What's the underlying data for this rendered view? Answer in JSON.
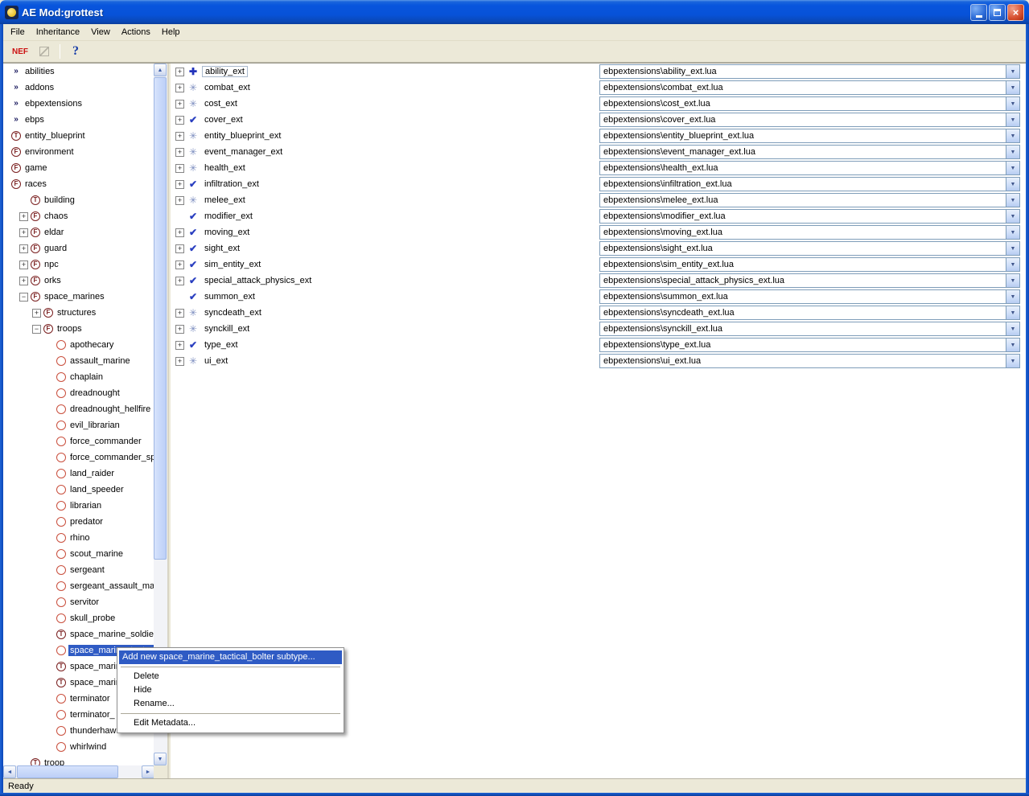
{
  "window": {
    "title": "AE Mod:grottest",
    "status": "Ready"
  },
  "menu": {
    "items": [
      "File",
      "Inheritance",
      "View",
      "Actions",
      "Help"
    ]
  },
  "toolbar": {
    "nef_label": "NEF",
    "help_label": "?"
  },
  "icons": {
    "chevron": "»",
    "plus": "✚",
    "gear": "✳",
    "check": "✔",
    "combo_arrow": "▼",
    "scroll_up": "▲",
    "scroll_down": "▼",
    "scroll_left": "◄",
    "scroll_right": "►",
    "expand_plus": "+",
    "expand_minus": "−"
  },
  "tree": {
    "items": [
      {
        "label": "abilities",
        "indent": 0,
        "icon": "chevron"
      },
      {
        "label": "addons",
        "indent": 0,
        "icon": "chevron"
      },
      {
        "label": "ebpextensions",
        "indent": 0,
        "icon": "chevron"
      },
      {
        "label": "ebps",
        "indent": 0,
        "icon": "chevron"
      },
      {
        "label": "entity_blueprint",
        "indent": 0,
        "icon": "T"
      },
      {
        "label": "environment",
        "indent": 0,
        "icon": "F"
      },
      {
        "label": "game",
        "indent": 0,
        "icon": "F"
      },
      {
        "label": "races",
        "indent": 0,
        "icon": "F"
      },
      {
        "label": "building",
        "indent": 1,
        "icon": "T"
      },
      {
        "label": "chaos",
        "indent": 1,
        "icon": "F",
        "expand": "+"
      },
      {
        "label": "eldar",
        "indent": 1,
        "icon": "F",
        "expand": "+"
      },
      {
        "label": "guard",
        "indent": 1,
        "icon": "F",
        "expand": "+"
      },
      {
        "label": "npc",
        "indent": 1,
        "icon": "F",
        "expand": "+"
      },
      {
        "label": "orks",
        "indent": 1,
        "icon": "F",
        "expand": "+"
      },
      {
        "label": "space_marines",
        "indent": 1,
        "icon": "F",
        "expand": "-"
      },
      {
        "label": "structures",
        "indent": 2,
        "icon": "F",
        "expand": "+"
      },
      {
        "label": "troops",
        "indent": 2,
        "icon": "F",
        "expand": "-"
      },
      {
        "label": "apothecary",
        "indent": 3,
        "icon": "circle"
      },
      {
        "label": "assault_marine",
        "indent": 3,
        "icon": "circle"
      },
      {
        "label": "chaplain",
        "indent": 3,
        "icon": "circle"
      },
      {
        "label": "dreadnought",
        "indent": 3,
        "icon": "circle"
      },
      {
        "label": "dreadnought_hellfire",
        "indent": 3,
        "icon": "circle"
      },
      {
        "label": "evil_librarian",
        "indent": 3,
        "icon": "circle"
      },
      {
        "label": "force_commander",
        "indent": 3,
        "icon": "circle"
      },
      {
        "label": "force_commander_sp",
        "indent": 3,
        "icon": "circle"
      },
      {
        "label": "land_raider",
        "indent": 3,
        "icon": "circle"
      },
      {
        "label": "land_speeder",
        "indent": 3,
        "icon": "circle"
      },
      {
        "label": "librarian",
        "indent": 3,
        "icon": "circle"
      },
      {
        "label": "predator",
        "indent": 3,
        "icon": "circle"
      },
      {
        "label": "rhino",
        "indent": 3,
        "icon": "circle"
      },
      {
        "label": "scout_marine",
        "indent": 3,
        "icon": "circle"
      },
      {
        "label": "sergeant",
        "indent": 3,
        "icon": "circle"
      },
      {
        "label": "sergeant_assault_ma",
        "indent": 3,
        "icon": "circle"
      },
      {
        "label": "servitor",
        "indent": 3,
        "icon": "circle"
      },
      {
        "label": "skull_probe",
        "indent": 3,
        "icon": "circle"
      },
      {
        "label": "space_marine_soldier",
        "indent": 3,
        "icon": "T"
      },
      {
        "label": "space_marine_tact",
        "indent": 3,
        "icon": "circle",
        "selected": true
      },
      {
        "label": "space_marine",
        "indent": 3,
        "icon": "T"
      },
      {
        "label": "space_marine",
        "indent": 3,
        "icon": "T"
      },
      {
        "label": "terminator",
        "indent": 3,
        "icon": "circle"
      },
      {
        "label": "terminator_",
        "indent": 3,
        "icon": "circle"
      },
      {
        "label": "thunderhaw",
        "indent": 3,
        "icon": "circle"
      },
      {
        "label": "whirlwind",
        "indent": 3,
        "icon": "circle"
      },
      {
        "label": "troop",
        "indent": 1,
        "icon": "T"
      }
    ]
  },
  "extensions": {
    "rows": [
      {
        "name": "ability_ext",
        "icon": "plus",
        "expand": true,
        "file": "ebpextensions\\ability_ext.lua"
      },
      {
        "name": "combat_ext",
        "icon": "gear",
        "expand": true,
        "file": "ebpextensions\\combat_ext.lua"
      },
      {
        "name": "cost_ext",
        "icon": "gear",
        "expand": true,
        "file": "ebpextensions\\cost_ext.lua"
      },
      {
        "name": "cover_ext",
        "icon": "check",
        "expand": true,
        "file": "ebpextensions\\cover_ext.lua"
      },
      {
        "name": "entity_blueprint_ext",
        "icon": "gear",
        "expand": true,
        "file": "ebpextensions\\entity_blueprint_ext.lua"
      },
      {
        "name": "event_manager_ext",
        "icon": "gear",
        "expand": true,
        "file": "ebpextensions\\event_manager_ext.lua"
      },
      {
        "name": "health_ext",
        "icon": "gear",
        "expand": true,
        "file": "ebpextensions\\health_ext.lua"
      },
      {
        "name": "infiltration_ext",
        "icon": "check",
        "expand": true,
        "file": "ebpextensions\\infiltration_ext.lua"
      },
      {
        "name": "melee_ext",
        "icon": "gear",
        "expand": true,
        "file": "ebpextensions\\melee_ext.lua"
      },
      {
        "name": "modifier_ext",
        "icon": "check",
        "expand": false,
        "file": "ebpextensions\\modifier_ext.lua"
      },
      {
        "name": "moving_ext",
        "icon": "check",
        "expand": true,
        "file": "ebpextensions\\moving_ext.lua"
      },
      {
        "name": "sight_ext",
        "icon": "check",
        "expand": true,
        "file": "ebpextensions\\sight_ext.lua"
      },
      {
        "name": "sim_entity_ext",
        "icon": "check",
        "expand": true,
        "file": "ebpextensions\\sim_entity_ext.lua"
      },
      {
        "name": "special_attack_physics_ext",
        "icon": "check",
        "expand": true,
        "file": "ebpextensions\\special_attack_physics_ext.lua"
      },
      {
        "name": "summon_ext",
        "icon": "check",
        "expand": false,
        "file": "ebpextensions\\summon_ext.lua"
      },
      {
        "name": "syncdeath_ext",
        "icon": "gear",
        "expand": true,
        "file": "ebpextensions\\syncdeath_ext.lua"
      },
      {
        "name": "synckill_ext",
        "icon": "gear",
        "expand": true,
        "file": "ebpextensions\\synckill_ext.lua"
      },
      {
        "name": "type_ext",
        "icon": "check",
        "expand": true,
        "file": "ebpextensions\\type_ext.lua"
      },
      {
        "name": "ui_ext",
        "icon": "gear",
        "expand": true,
        "file": "ebpextensions\\ui_ext.lua"
      }
    ]
  },
  "context_menu": {
    "items": [
      {
        "type": "item",
        "label": "Add new space_marine_tactical_bolter subtype...",
        "highlighted": true
      },
      {
        "type": "separator"
      },
      {
        "type": "item",
        "label": "Delete"
      },
      {
        "type": "item",
        "label": "Hide"
      },
      {
        "type": "item",
        "label": "Rename..."
      },
      {
        "type": "separator"
      },
      {
        "type": "item",
        "label": "Edit Metadata..."
      }
    ]
  },
  "colors": {
    "selection": "#2F5BC4",
    "titlebar": "#0855DD",
    "panel_bg": "#ECE9D8",
    "combo_border": "#7F9DB9",
    "unit_circle": "#C94F3D",
    "letter_circle": "#7A1F1F"
  }
}
